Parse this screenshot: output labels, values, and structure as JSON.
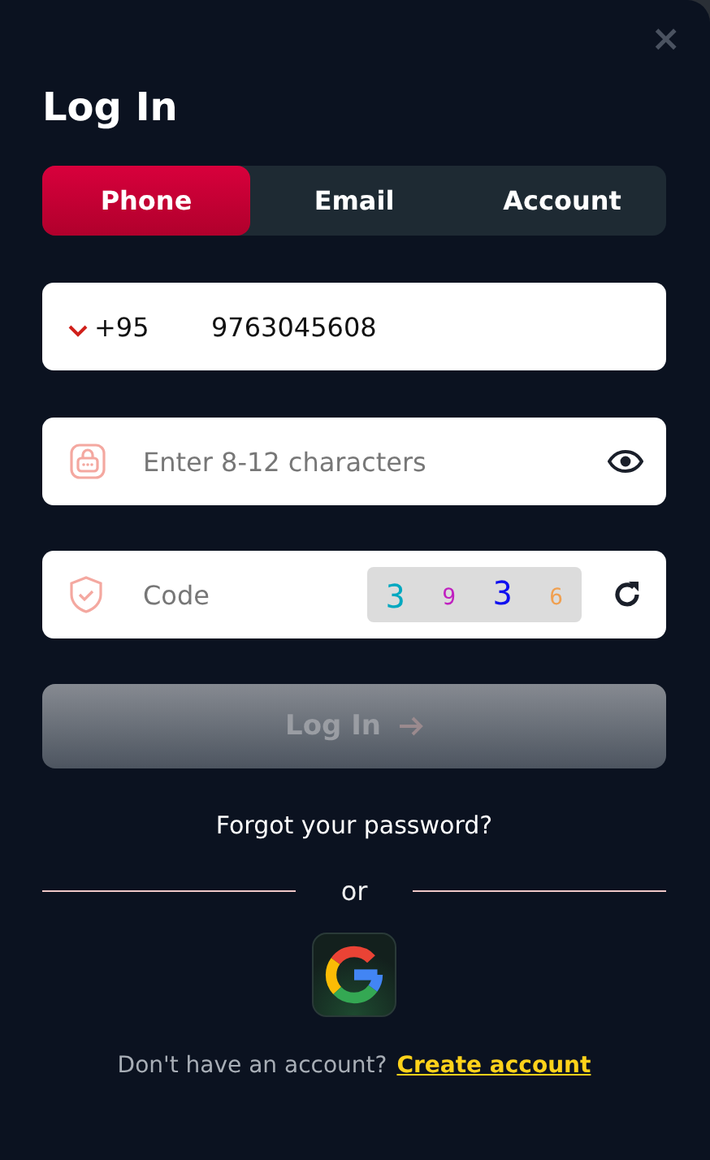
{
  "dialog": {
    "title": "Log In",
    "close": "×"
  },
  "tabs": [
    {
      "label": "Phone",
      "selected": true
    },
    {
      "label": "Email",
      "selected": false
    },
    {
      "label": "Account",
      "selected": false
    }
  ],
  "phone": {
    "country_code": "+95",
    "value": "9763045608"
  },
  "password": {
    "placeholder": "Enter 8-12 characters"
  },
  "code": {
    "placeholder": "Code",
    "captcha": [
      {
        "char": "3",
        "color": "#00a8c0"
      },
      {
        "char": "9",
        "color": "#c020c0"
      },
      {
        "char": "3",
        "color": "#1010f0"
      },
      {
        "char": "6",
        "color": "#f0a050"
      }
    ]
  },
  "submit": {
    "label": "Log In",
    "disabled": true
  },
  "forgot_link": "Forgot your password?",
  "divider": "or",
  "signup": {
    "prompt": "Don't have an account?",
    "link": "Create account"
  }
}
